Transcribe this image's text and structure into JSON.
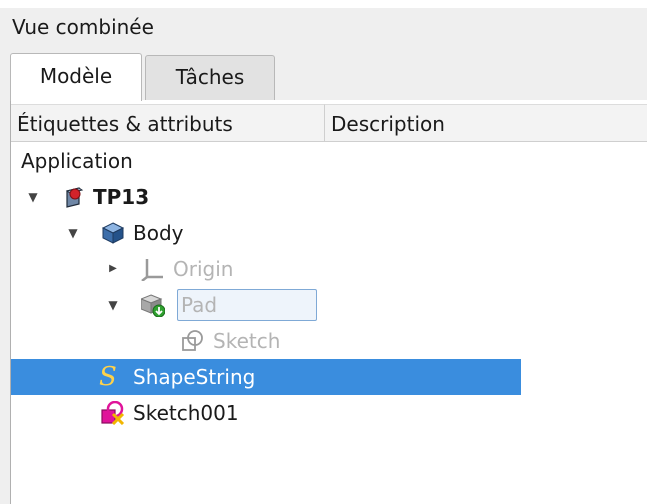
{
  "panel": {
    "title": "Vue combinée"
  },
  "tabs": [
    {
      "label": "Modèle",
      "active": true
    },
    {
      "label": "Tâches",
      "active": false
    }
  ],
  "columns": [
    "Étiquettes & attributs",
    "Description"
  ],
  "tree": {
    "root": "Application",
    "items": [
      {
        "label": "TP13",
        "icon": "document-icon",
        "expanded": true,
        "bold": true
      },
      {
        "label": "Body",
        "icon": "body-icon",
        "expanded": true
      },
      {
        "label": "Origin",
        "icon": "origin-icon",
        "expanded": false,
        "hidden": true
      },
      {
        "label": "Pad",
        "icon": "pad-icon",
        "expanded": true,
        "hidden": true,
        "editing": true
      },
      {
        "label": "Sketch",
        "icon": "sketch-icon",
        "hidden": true
      },
      {
        "label": "ShapeString",
        "icon": "shapestring-icon",
        "selected": true
      },
      {
        "label": "Sketch001",
        "icon": "sketch-error-icon"
      }
    ]
  },
  "colors": {
    "selection": "#3a8dde",
    "muted_text": "#b4b4b4"
  }
}
